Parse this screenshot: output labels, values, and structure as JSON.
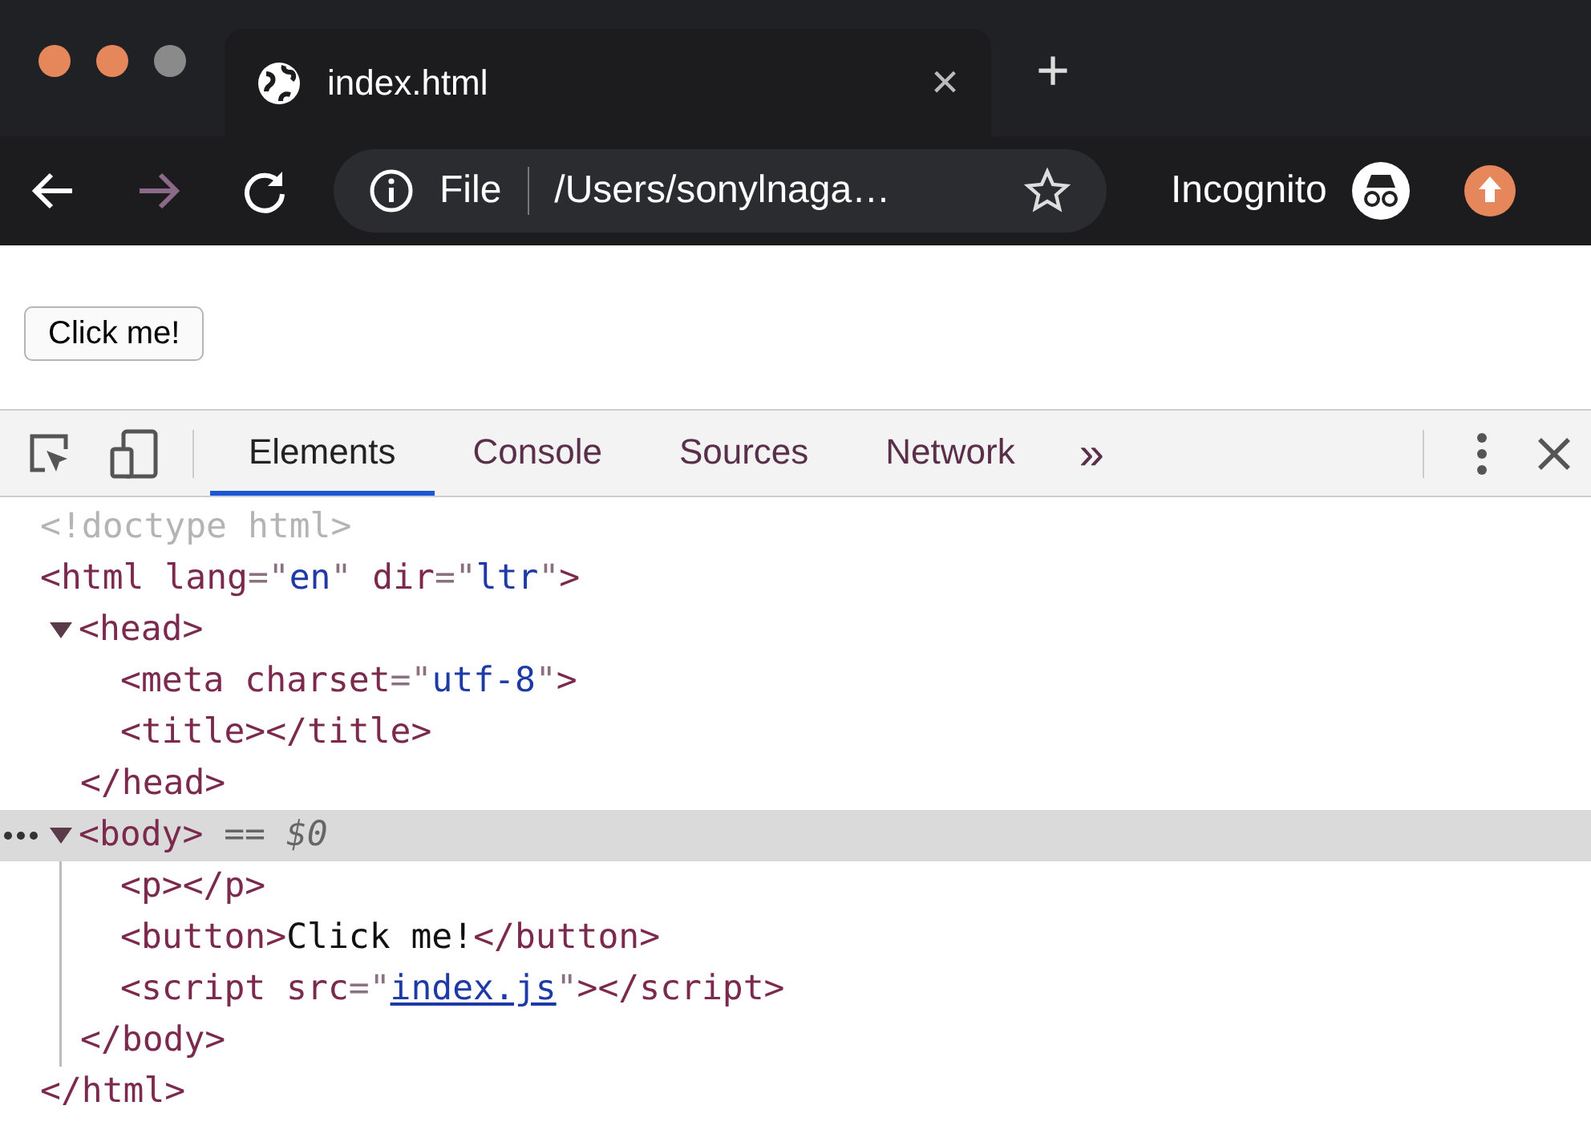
{
  "window": {
    "controls": [
      {
        "color": "#e5875a"
      },
      {
        "color": "#e5875a"
      },
      {
        "color": "#8a8a8a"
      }
    ]
  },
  "tab": {
    "title": "index.html",
    "close": "×",
    "new_tab": "+"
  },
  "toolbar": {
    "back_disabled": false,
    "forward_disabled": true,
    "scheme": "File",
    "url": "/Users/sonylnaga…",
    "profile": "Incognito"
  },
  "page": {
    "button": "Click me!"
  },
  "devtools": {
    "tabs": [
      {
        "label": "Elements",
        "selected": true
      },
      {
        "label": "Console",
        "selected": false
      },
      {
        "label": "Sources",
        "selected": false
      },
      {
        "label": "Network",
        "selected": false
      }
    ],
    "overflow": "»"
  },
  "dom": [
    {
      "selected": false,
      "tokens": [
        {
          "kind": "comment",
          "text": "<!doctype html>"
        }
      ]
    },
    {
      "selected": false,
      "tokens": [
        {
          "kind": "tag",
          "text": "<html"
        },
        {
          "kind": "attr",
          "text": " lang"
        },
        {
          "kind": "punct",
          "text": "=\""
        },
        {
          "kind": "value",
          "text": "en"
        },
        {
          "kind": "punct",
          "text": "\""
        },
        {
          "kind": "attr",
          "text": " dir"
        },
        {
          "kind": "punct",
          "text": "=\""
        },
        {
          "kind": "value",
          "text": "ltr"
        },
        {
          "kind": "punct",
          "text": "\""
        },
        {
          "kind": "tag",
          "text": ">"
        }
      ],
      "children": [
        {
          "selected": false,
          "expanded": true,
          "tokens": [
            {
              "kind": "tag",
              "text": "<head>"
            }
          ],
          "children": [
            {
              "selected": false,
              "tokens": [
                {
                  "kind": "tag",
                  "text": "<meta"
                },
                {
                  "kind": "attr",
                  "text": " charset"
                },
                {
                  "kind": "punct",
                  "text": "=\""
                },
                {
                  "kind": "value",
                  "text": "utf-8"
                },
                {
                  "kind": "punct",
                  "text": "\""
                },
                {
                  "kind": "tag",
                  "text": ">"
                }
              ]
            },
            {
              "selected": false,
              "tokens": [
                {
                  "kind": "tag",
                  "text": "<title></title>"
                }
              ]
            }
          ],
          "close": [
            {
              "kind": "tag",
              "text": "</head>"
            }
          ]
        },
        {
          "selected": true,
          "expanded": true,
          "tokens": [
            {
              "kind": "tag",
              "text": "<body>"
            },
            {
              "kind": "marker",
              "text": " == $0"
            }
          ],
          "children": [
            {
              "selected": false,
              "tokens": [
                {
                  "kind": "tag",
                  "text": "<p></p>"
                }
              ]
            },
            {
              "selected": false,
              "tokens": [
                {
                  "kind": "tag",
                  "text": "<button>"
                },
                {
                  "kind": "text",
                  "text": "Click me!"
                },
                {
                  "kind": "tag",
                  "text": "</button>"
                }
              ]
            },
            {
              "selected": false,
              "tokens": [
                {
                  "kind": "tag",
                  "text": "<script"
                },
                {
                  "kind": "attr",
                  "text": " src"
                },
                {
                  "kind": "punct",
                  "text": "=\""
                },
                {
                  "kind": "link",
                  "text": "index.js"
                },
                {
                  "kind": "punct",
                  "text": "\""
                },
                {
                  "kind": "tag",
                  "text": "></script>"
                }
              ]
            }
          ],
          "close": [
            {
              "kind": "tag",
              "text": "</body>"
            }
          ]
        }
      ],
      "close": [
        {
          "kind": "tag",
          "text": "</html>"
        }
      ]
    }
  ]
}
